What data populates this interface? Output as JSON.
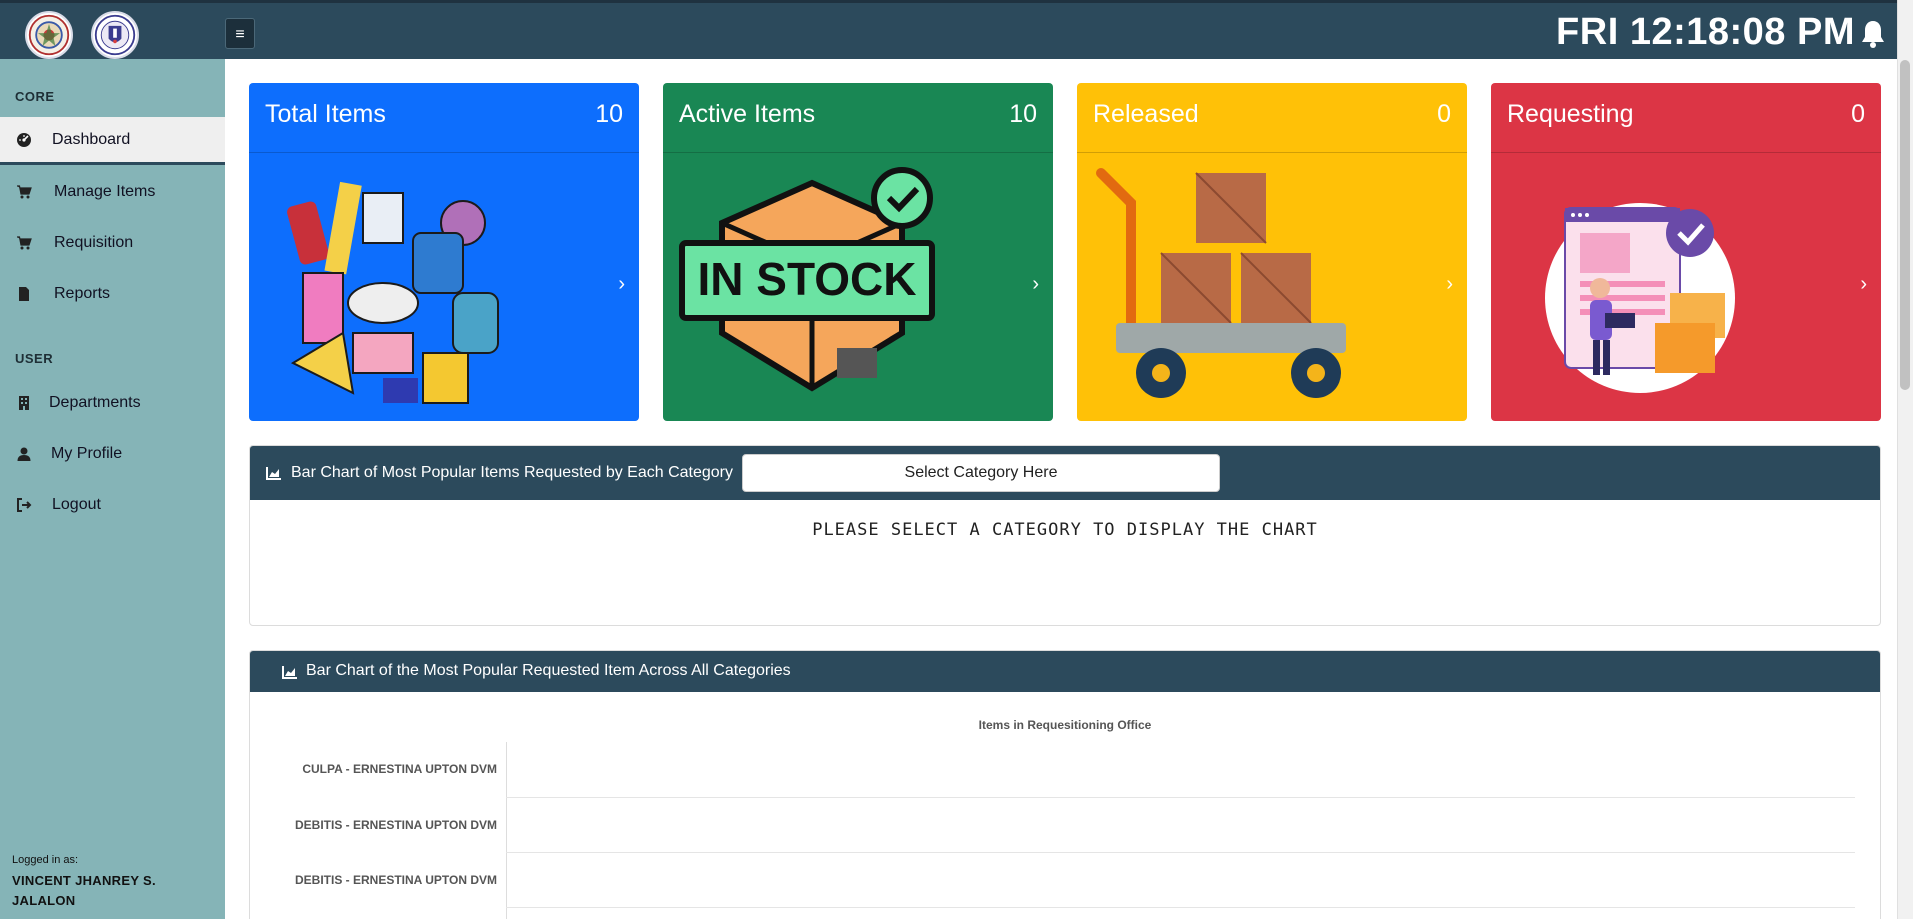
{
  "topbar": {
    "clock": "FRI 12:18:08 PM",
    "menu_glyph": "≡"
  },
  "sidebar": {
    "sections": [
      {
        "heading": "CORE"
      },
      {
        "heading": "USER"
      }
    ],
    "items": [
      {
        "label": "Dashboard",
        "icon": "tachometer-icon",
        "active": true
      },
      {
        "label": "Manage Items",
        "icon": "cart-icon"
      },
      {
        "label": "Requisition",
        "icon": "cart-icon"
      },
      {
        "label": "Reports",
        "icon": "file-icon"
      },
      {
        "label": "Departments",
        "icon": "building-icon"
      },
      {
        "label": "My Profile",
        "icon": "user-icon"
      },
      {
        "label": "Logout",
        "icon": "sign-out-icon"
      }
    ],
    "logged_in_label": "Logged in as:",
    "logged_in_name": "VINCENT JHANREY S. JALALON"
  },
  "cards": [
    {
      "title": "Total Items",
      "count": "10",
      "color": "#0d6efd"
    },
    {
      "title": "Active Items",
      "count": "10",
      "color": "#198754"
    },
    {
      "title": "Released",
      "count": "0",
      "color": "#ffc107"
    },
    {
      "title": "Requesting",
      "count": "0",
      "color": "#dc3545"
    }
  ],
  "card_image_text": "IN STOCK",
  "category_panel": {
    "title": "Bar Chart of Most Popular Items Requested by Each Category",
    "select_placeholder": "Select Category Here",
    "message": "PLEASE SELECT A CATEGORY TO DISPLAY THE CHART"
  },
  "popular_panel": {
    "title": "Bar Chart of the Most Popular Requested Item Across All Categories"
  },
  "chart_data": {
    "type": "bar",
    "title": "Items in Requesitioning Office",
    "categories": [
      "CULPA - ERNESTINA UPTON DVM",
      "DEBITIS - ERNESTINA UPTON DVM",
      "DEBITIS - ERNESTINA UPTON DVM"
    ],
    "values": [
      0,
      0,
      0
    ],
    "orientation": "horizontal",
    "grid": true
  },
  "colors": {
    "topbar": "#2c4a5c",
    "sidebar": "#85b4b7",
    "panel_header": "#2c4a5c"
  }
}
